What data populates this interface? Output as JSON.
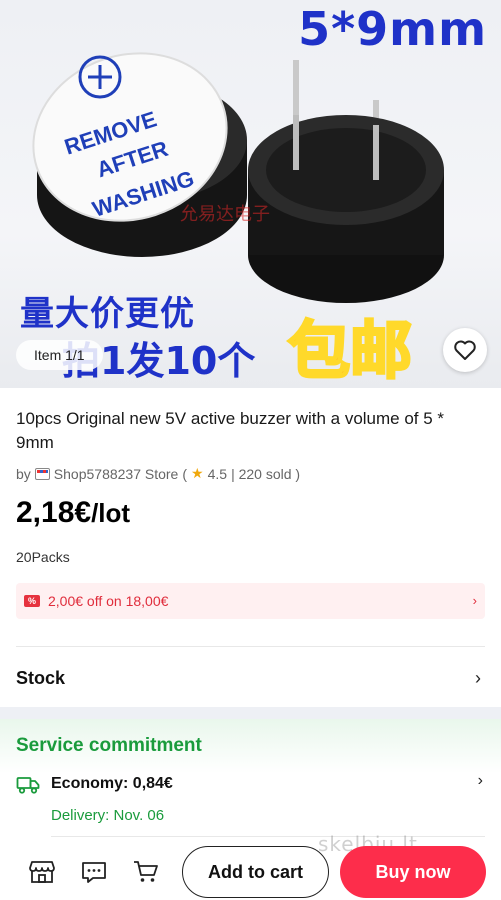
{
  "gallery": {
    "image_text_size": "5*9mm",
    "image_label_remove": "REMOVE",
    "image_label_after": "AFTER",
    "image_label_washing": "WASHING",
    "image_watermark_cn": "允易达电子",
    "image_promo_line1": "量大价更优",
    "image_promo_line2": "拍1发10个",
    "image_promo_free_shipping": "包邮",
    "item_counter": "Item 1/1"
  },
  "product": {
    "title": "10pcs Original new 5V active buzzer with a volume of 5 * 9mm",
    "by_label": "by",
    "store_name": "Shop5788237 Store",
    "rating_open": "(",
    "rating": "4.5",
    "sold": "| 220 sold )",
    "price": "2,18€",
    "unit": "/lot",
    "packs": "20Packs"
  },
  "coupon": {
    "icon_text": "%",
    "text": "2,00€ off on 18,00€"
  },
  "stock": {
    "label": "Stock"
  },
  "service": {
    "title": "Service commitment",
    "shipping": "Economy: 0,84€",
    "delivery": "Delivery: Nov. 06"
  },
  "actions": {
    "add_to_cart": "Add to cart",
    "buy_now": "Buy now"
  },
  "watermark": "skelbiu.lt",
  "colors": {
    "accent_red": "#fd2d4b",
    "service_green": "#1a9b3c",
    "coupon_red": "#e02d3c",
    "image_blue": "#1f32c8"
  }
}
